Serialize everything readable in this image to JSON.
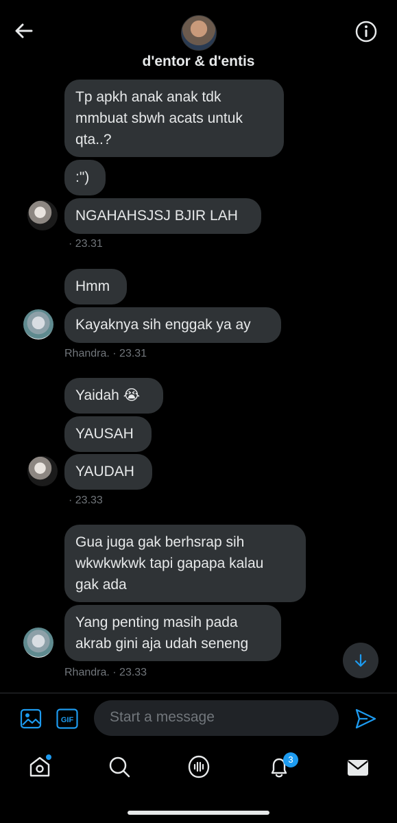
{
  "header": {
    "title": "d'entor & d'entis"
  },
  "messages": [
    {
      "text": "Tp apkh anak anak tdk\nmmbuat sbwh acats untuk\nqta..?"
    },
    {
      "text": ":\")"
    },
    {
      "text": "NGAHAHSJSJ BJIR LAH"
    },
    {
      "text": "Hmm"
    },
    {
      "text": "Kayaknya sih enggak ya ay"
    },
    {
      "text": "Yaidah 😭"
    },
    {
      "text": "YAUSAH"
    },
    {
      "text": "YAUDAH"
    },
    {
      "text": "Gua juga gak berhsrap sih\nwkwkwkwk tapi gapapa kalau\ngak ada"
    },
    {
      "text": "Yang penting masih pada\nakrab gini aja udah seneng"
    }
  ],
  "meta": {
    "m1": "· 23.31",
    "m2": "Rhandra.  · 23.31",
    "m3": "· 23.33",
    "m4": "Rhandra.  · 23.33"
  },
  "composer": {
    "placeholder": "Start a message"
  },
  "tabbar": {
    "notifications_badge": "3"
  },
  "colors": {
    "accent": "#1d9bf0",
    "bubble": "#2f3336",
    "background": "#000000"
  },
  "icons": [
    "back-arrow-icon",
    "info-icon",
    "image-icon",
    "gif-icon",
    "send-icon",
    "home-icon",
    "search-icon",
    "spaces-icon",
    "bell-icon",
    "mail-icon",
    "arrow-down-icon"
  ]
}
